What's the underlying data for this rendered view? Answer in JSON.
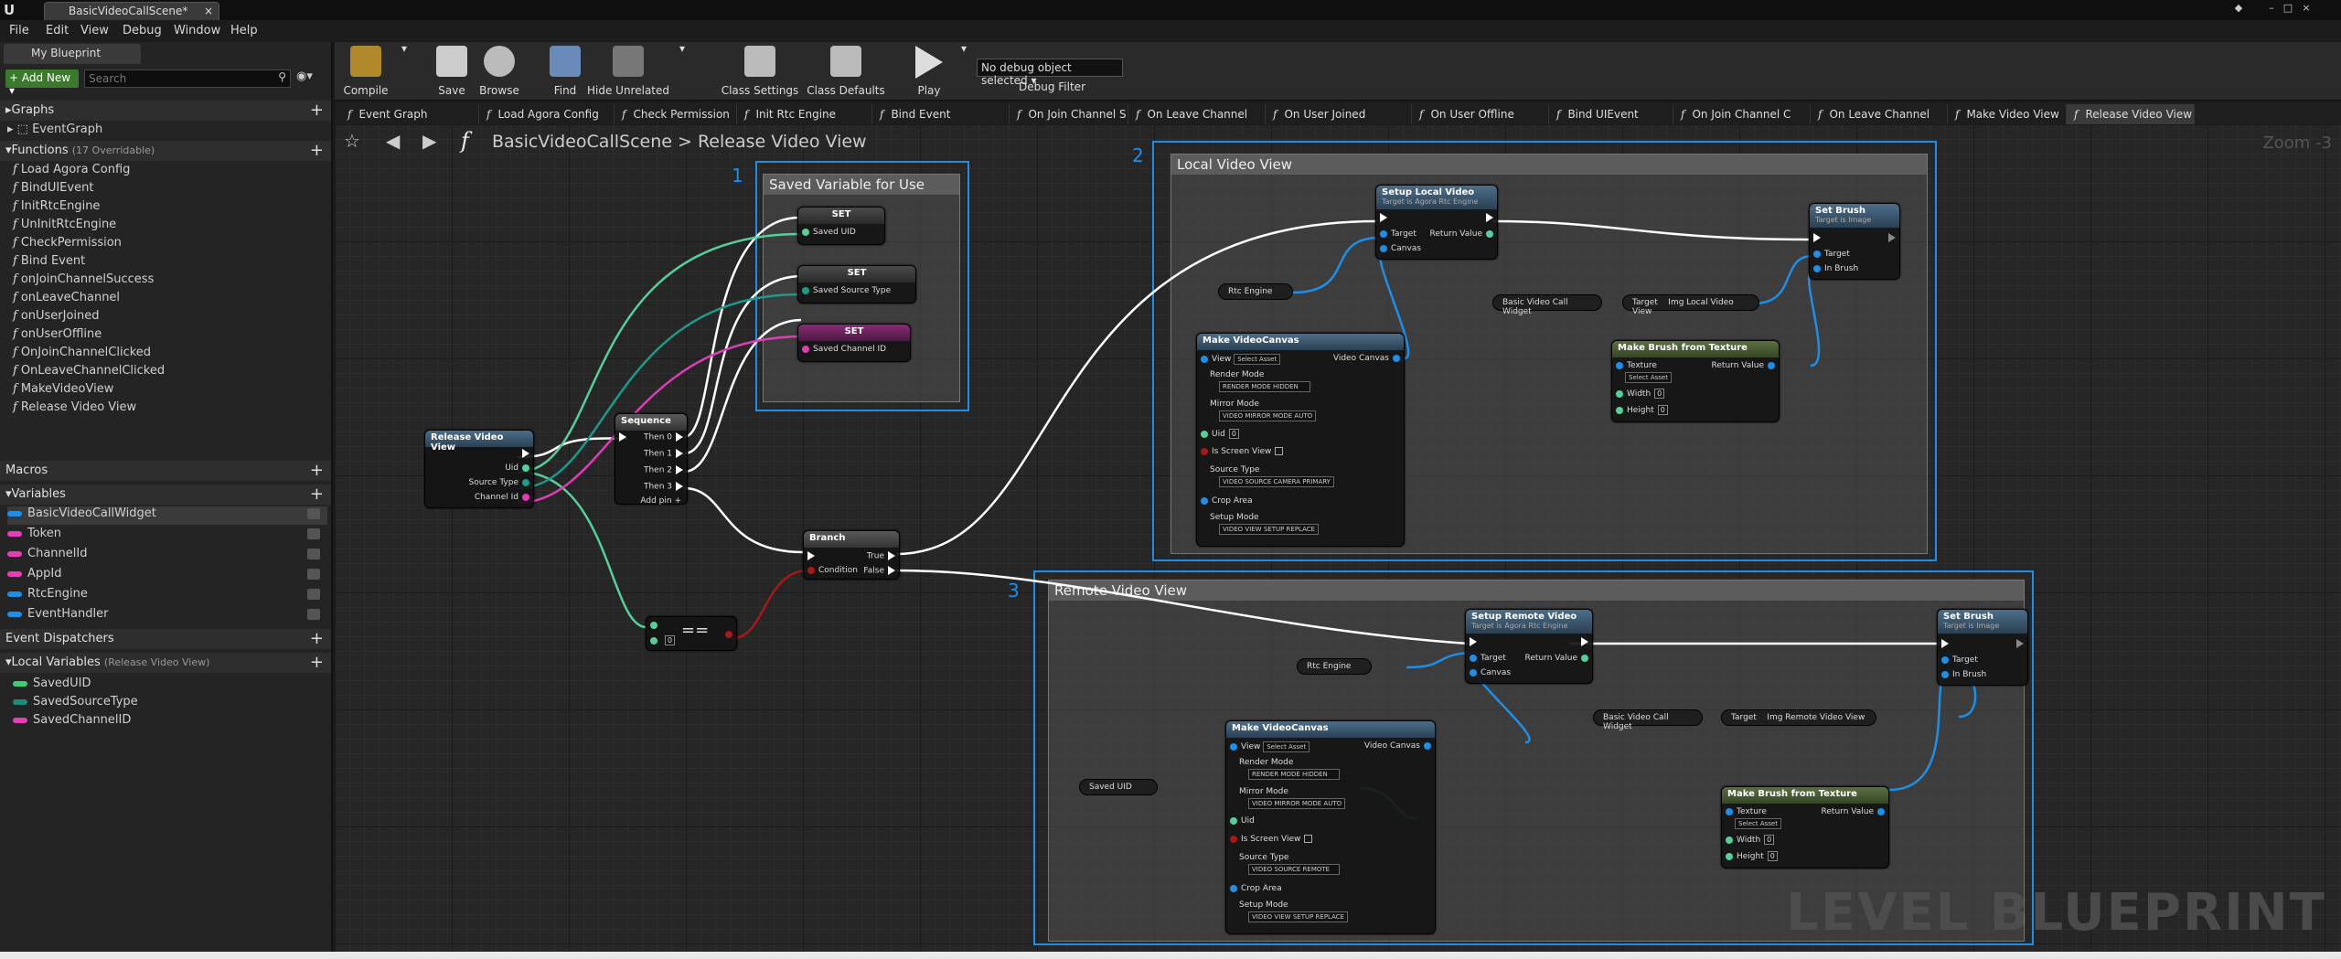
{
  "window": {
    "tab": "BasicVideoCallScene*"
  },
  "menu": [
    "File",
    "Edit",
    "View",
    "Debug",
    "Window",
    "Help"
  ],
  "left": {
    "tab": "My Blueprint",
    "add_new": "+ Add New ▾",
    "search_placeholder": "Search",
    "graphs_label": "Graphs",
    "event_graph": "EventGraph",
    "functions_label": "Functions",
    "functions_sub": "(17 Overridable)",
    "functions": [
      "Load Agora Config",
      "BindUIEvent",
      "InitRtcEngine",
      "UnInitRtcEngine",
      "CheckPermission",
      "Bind Event",
      "onJoinChannelSuccess",
      "onLeaveChannel",
      "onUserJoined",
      "onUserOffline",
      "OnJoinChannelClicked",
      "OnLeaveChannelClicked",
      "MakeVideoView",
      "Release Video View"
    ],
    "macros_label": "Macros",
    "variables_label": "Variables",
    "variables": [
      {
        "name": "BasicVideoCallWidget",
        "color": "#1d8fe8"
      },
      {
        "name": "Token",
        "color": "#e83cb8"
      },
      {
        "name": "ChannelId",
        "color": "#e83cb8"
      },
      {
        "name": "AppId",
        "color": "#e83cb8"
      },
      {
        "name": "RtcEngine",
        "color": "#1d8fe8"
      },
      {
        "name": "EventHandler",
        "color": "#1d8fe8"
      }
    ],
    "dispatchers_label": "Event Dispatchers",
    "local_label": "Local Variables",
    "local_sub": "(Release Video View)",
    "locals": [
      {
        "name": "SavedUID",
        "color": "#3ad07a"
      },
      {
        "name": "SavedSourceType",
        "color": "#1a8f80"
      },
      {
        "name": "SavedChannelID",
        "color": "#e83cb8"
      }
    ]
  },
  "toolbar": {
    "compile": "Compile",
    "save": "Save",
    "browse": "Browse",
    "find": "Find",
    "hide": "Hide Unrelated",
    "class_settings": "Class Settings",
    "class_defaults": "Class Defaults",
    "play": "Play",
    "debug_value": "No debug object selected ▾",
    "debug_label": "Debug Filter"
  },
  "tabs": [
    "Event Graph",
    "Load Agora Config",
    "Check Permission",
    "Init Rtc Engine",
    "Bind Event",
    "On Join Channel S",
    "On Leave Channel",
    "On User Joined",
    "On User Offline",
    "Bind UIEvent",
    "On Join Channel C",
    "On Leave Channel",
    "Make Video View",
    "Release Video View"
  ],
  "breadcrumb": {
    "scene": "BasicVideoCallScene",
    "sep": ">",
    "fn": "Release Video View"
  },
  "zoom": "Zoom -3",
  "watermark": "LEVEL BLUEPRINT",
  "comments": {
    "c1": "Saved Variable for Use",
    "c2": "Local Video View",
    "c3": "Remote Video View"
  },
  "nums": {
    "n1": "1",
    "n2": "2",
    "n3": "3"
  },
  "nodes": {
    "release": {
      "title": "Release Video View",
      "uid": "Uid",
      "source": "Source Type",
      "channel": "Channel Id"
    },
    "sequence": {
      "title": "Sequence",
      "then0": "Then 0",
      "then1": "Then 1",
      "then2": "Then 2",
      "then3": "Then 3",
      "addpin": "Add pin"
    },
    "set": "SET",
    "set1": "Saved UID",
    "set2": "Saved Source Type",
    "set3": "Saved Channel ID",
    "branch": {
      "title": "Branch",
      "cond": "Condition",
      "t": "True",
      "f": "False"
    },
    "eq": "==",
    "eqval": "0",
    "setup_local": {
      "title": "Setup Local Video",
      "sub": "Target is Agora Rtc Engine",
      "target": "Target",
      "canvas": "Canvas",
      "ret": "Return Value"
    },
    "setup_remote": {
      "title": "Setup Remote Video",
      "sub": "Target is Agora Rtc Engine",
      "target": "Target",
      "canvas": "Canvas",
      "ret": "Return Value"
    },
    "setbrush": {
      "title": "Set Brush",
      "sub": "Target is Image",
      "target": "Target",
      "inbrush": "In Brush"
    },
    "mvc": {
      "title": "Make VideoCanvas",
      "view": "View",
      "select": "Select Asset",
      "vc": "Video Canvas",
      "render": "Render Mode",
      "render_v": "RENDER MODE HIDDEN",
      "mirror": "Mirror Mode",
      "mirror_v": "VIDEO MIRROR MODE AUTO",
      "uid": "Uid",
      "uid_v": "0",
      "screen": "Is Screen View",
      "source": "Source Type",
      "source_local": "VIDEO SOURCE CAMERA PRIMARY",
      "source_remote": "VIDEO SOURCE REMOTE",
      "crop": "Crop Area",
      "setup": "Setup Mode",
      "setup_v": "VIDEO VIEW SETUP REPLACE"
    },
    "mbt": {
      "title": "Make Brush from Texture",
      "texture": "Texture",
      "select": "Select Asset",
      "ret": "Return Value",
      "width": "Width",
      "height": "Height",
      "wv": "0",
      "hv": "0"
    },
    "rtc": "Rtc Engine",
    "widget": "Basic Video Call Widget",
    "target": "Target",
    "img_local": "Img Local Video View",
    "img_remote": "Img Remote Video View",
    "saved_uid": "Saved UID"
  }
}
